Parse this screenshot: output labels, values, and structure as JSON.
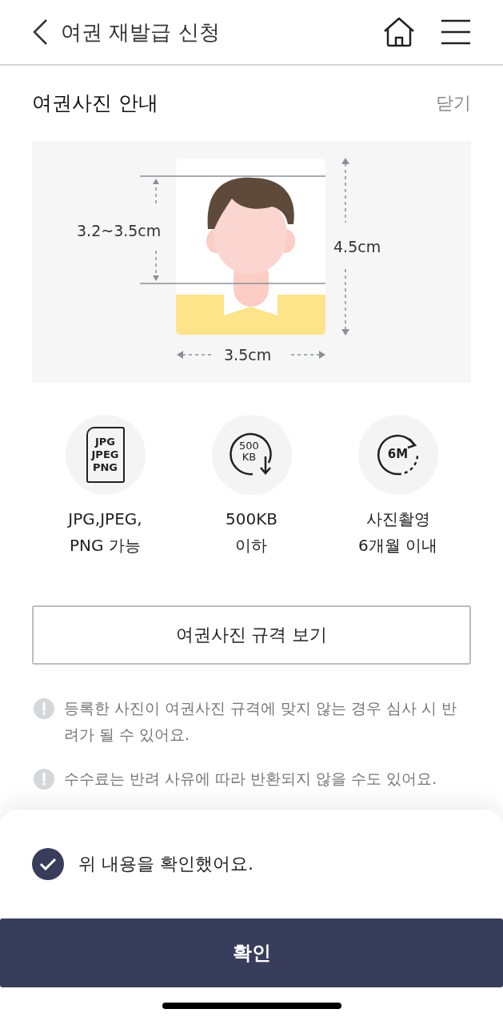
{
  "header": {
    "title": "여권 재발급 신청"
  },
  "section": {
    "title": "여권사진 안내",
    "close": "닫기"
  },
  "diagram": {
    "face_height": "3.2~3.5cm",
    "photo_height": "4.5cm",
    "photo_width": "3.5cm"
  },
  "requirements": [
    {
      "kind": "formats",
      "icon_text": [
        "JPG",
        "JPEG",
        "PNG"
      ],
      "label": [
        "JPG,JPEG,",
        "PNG 가능"
      ]
    },
    {
      "kind": "size",
      "icon_text": [
        "500",
        "KB"
      ],
      "label": [
        "500KB",
        "이하"
      ]
    },
    {
      "kind": "age",
      "icon_text": [
        "6M"
      ],
      "label": [
        "사진촬영",
        "6개월 이내"
      ]
    }
  ],
  "spec_button": "여권사진 규격 보기",
  "notes": [
    "등록한 사진이 여권사진 규격에 맞지 않는 경우 심사 시 반려가 될 수 있어요.",
    "수수료는 반려 사유에 따라 반환되지 않을 수도 있어요."
  ],
  "agreement": {
    "label": "위 내용을 확인했어요.",
    "checked": true
  },
  "confirm_button": "확인"
}
